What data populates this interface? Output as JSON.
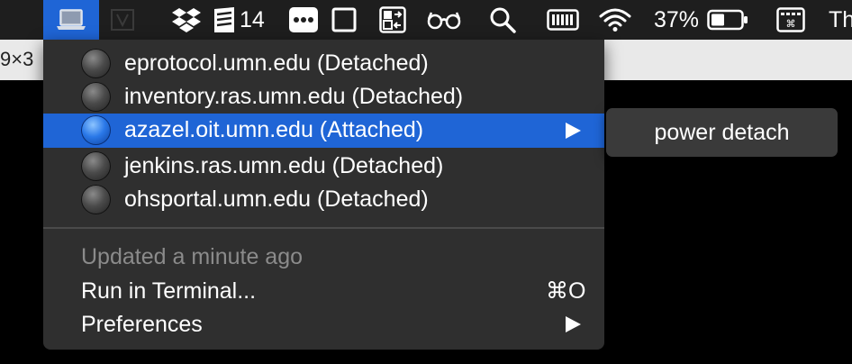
{
  "menubar": {
    "dropbox_badge": "",
    "todo_count": "14",
    "battery_percent": "37%",
    "clock_partial": "Th",
    "icons": [
      "laptop-icon",
      "vagrant-icon",
      "dropbox-icon",
      "todo-stack-icon",
      "more-icon",
      "square-window-icon",
      "app-switcher-icon",
      "glasses-icon",
      "search-icon",
      "memory-icon",
      "wifi-icon",
      "battery-icon",
      "keyboard-icon"
    ]
  },
  "behind_window": {
    "text": "9×3"
  },
  "menu": {
    "hosts": [
      {
        "label": "eprotocol.umn.edu (Detached)",
        "status": "detached"
      },
      {
        "label": "inventory.ras.umn.edu (Detached)",
        "status": "detached"
      },
      {
        "label": "azazel.oit.umn.edu (Attached)",
        "status": "attached"
      },
      {
        "label": "jenkins.ras.umn.edu (Detached)",
        "status": "detached"
      },
      {
        "label": "ohsportal.umn.edu (Detached)",
        "status": "detached"
      }
    ],
    "updated": "Updated a minute ago",
    "run_in_terminal": "Run in Terminal...",
    "run_shortcut": "⌘O",
    "preferences": "Preferences"
  },
  "submenu": {
    "power_detach": "power detach"
  },
  "colors": {
    "highlight": "#1f65d6",
    "menu_bg": "#2f2f2f",
    "menubar_bg": "#1e1e1e"
  }
}
